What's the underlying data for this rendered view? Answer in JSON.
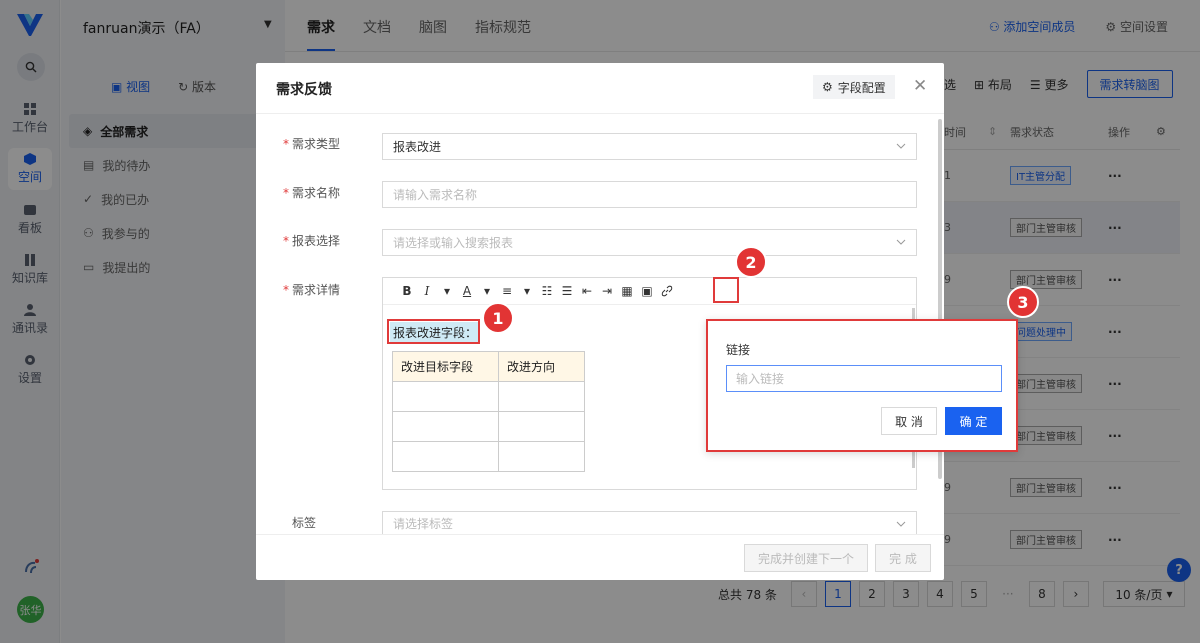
{
  "rail": {
    "items": [
      {
        "label": "工作台",
        "icon": "grid-icon"
      },
      {
        "label": "空间",
        "icon": "cube-icon"
      },
      {
        "label": "看板",
        "icon": "board-icon"
      },
      {
        "label": "知识库",
        "icon": "book-icon"
      },
      {
        "label": "通讯录",
        "icon": "contacts-icon"
      },
      {
        "label": "设置",
        "icon": "gear-icon"
      }
    ],
    "avatar": "张华"
  },
  "sidebar": {
    "workspace": "fanruan演示（FA）",
    "view_label": "视图",
    "version_label": "版本",
    "nav": [
      "全部需求",
      "我的待办",
      "我的已办",
      "我参与的",
      "我提出的"
    ]
  },
  "topbar": {
    "tabs": [
      "需求",
      "文档",
      "脑图",
      "指标规范"
    ],
    "add_member": "添加空间成员",
    "space_settings": "空间设置"
  },
  "toolbar": {
    "filter": "选",
    "layout": "布局",
    "more": "更多",
    "to_mindmap": "需求转脑图"
  },
  "table": {
    "headers": {
      "time": "时间",
      "status": "需求状态",
      "ops": "操作"
    },
    "rows": [
      {
        "time": "1",
        "status": "IT主管分配",
        "status_style": "blue"
      },
      {
        "time": "3",
        "status": "部门主管审核",
        "status_style": "gray"
      },
      {
        "time": "9",
        "status": "部门主管审核",
        "status_style": "gray"
      },
      {
        "time": "",
        "status": "问题处理中",
        "status_style": "blue"
      },
      {
        "time": "",
        "status": "部门主管审核",
        "status_style": "gray"
      },
      {
        "time": "",
        "status": "部门主管审核",
        "status_style": "gray"
      },
      {
        "time": "9",
        "status": "部门主管审核",
        "status_style": "gray"
      },
      {
        "time": "9",
        "status": "部门主管审核",
        "status_style": "gray"
      }
    ],
    "ops_glyph": "···"
  },
  "pagination": {
    "total": "总共 78 条",
    "pages": [
      "1",
      "2",
      "3",
      "4",
      "5"
    ],
    "ellipsis": "···",
    "last": "8",
    "page_size": "10 条/页"
  },
  "modal": {
    "title": "需求反馈",
    "field_config": "字段配置",
    "fields": {
      "type_label": "需求类型",
      "type_value": "报表改进",
      "name_label": "需求名称",
      "name_placeholder": "请输入需求名称",
      "report_label": "报表选择",
      "report_placeholder": "请选择或输入搜索报表",
      "detail_label": "需求详情",
      "tag_label": "标签",
      "tag_placeholder": "请选择标签"
    },
    "editor": {
      "tools": [
        "B",
        "I",
        "▾",
        "A",
        "▾",
        "≡",
        "▾"
      ],
      "highlight_text": "报表改进字段：",
      "table": [
        [
          "改进目标字段",
          "改进方向"
        ],
        [
          "",
          ""
        ],
        [
          "",
          ""
        ],
        [
          "",
          ""
        ]
      ]
    },
    "footer": {
      "create_next": "完成并创建下一个",
      "done": "完 成"
    }
  },
  "link_popup": {
    "label": "链接",
    "placeholder": "输入链接",
    "cancel": "取 消",
    "ok": "确 定"
  },
  "annotations": [
    "1",
    "2",
    "3"
  ],
  "colors": {
    "accent": "#1a62f0",
    "annotation_red": "#e23434"
  }
}
